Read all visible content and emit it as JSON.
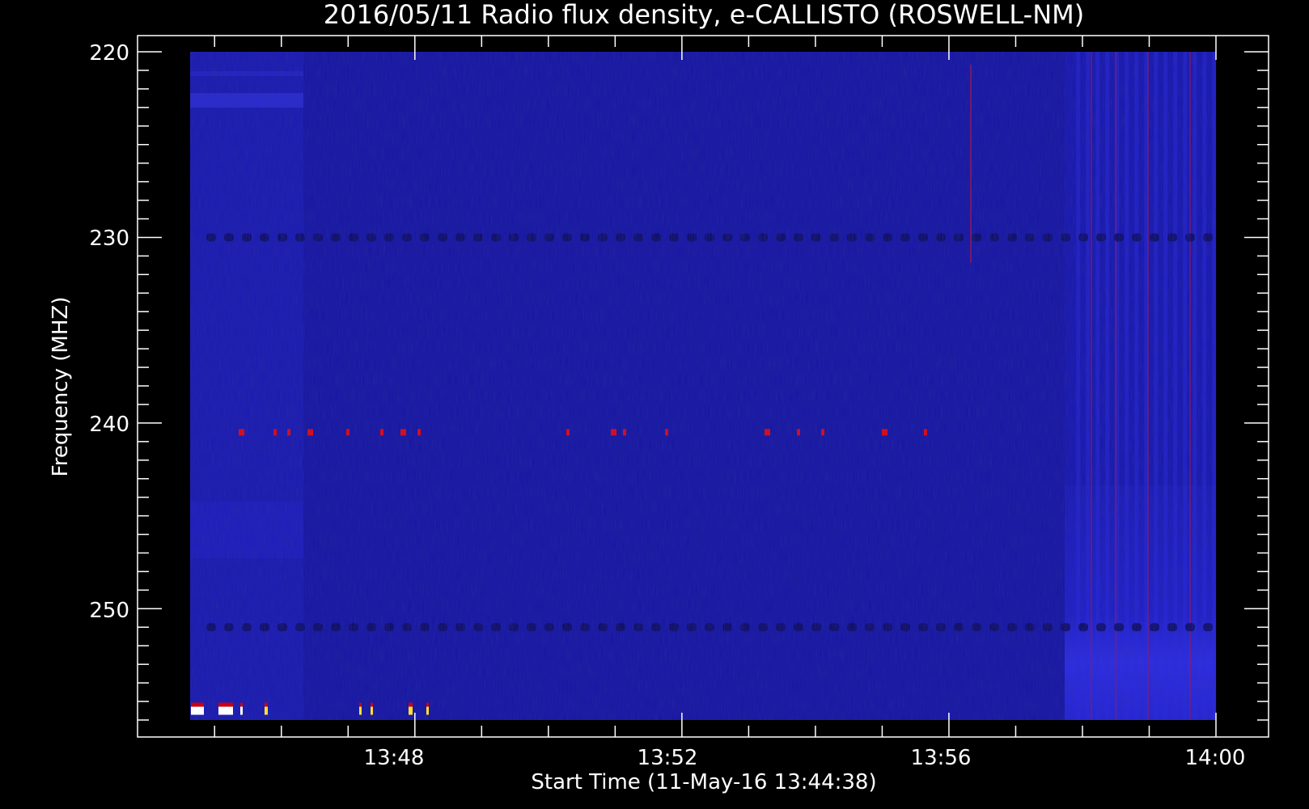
{
  "chart_data": {
    "type": "heatmap",
    "title": "2016/05/11  Radio flux density, e-CALLISTO (ROSWELL-NM)",
    "xlabel": "Start Time (11-May-16 13:44:38)",
    "ylabel": "Frequency (MHZ)",
    "x_ticks": [
      "13:48",
      "13:52",
      "13:56",
      "14:00"
    ],
    "y_ticks": [
      "220",
      "230",
      "240",
      "250"
    ],
    "y_range_mhz": [
      220,
      256
    ],
    "y_inverted": true,
    "x_range": [
      "13:44:38",
      "14:00:00"
    ],
    "colormap": [
      "#000014",
      "#1c1cd2",
      "#cc0010",
      "#ffe030",
      "#ffffff"
    ],
    "background_level": "medium-blue",
    "features": [
      {
        "label": "horizontal interference band",
        "freq_mhz": 230,
        "kind": "dark-dashed"
      },
      {
        "label": "horizontal interference band",
        "freq_mhz": 240.5,
        "kind": "red-blips"
      },
      {
        "label": "horizontal interference band",
        "freq_mhz": 251,
        "kind": "dark-dashed"
      },
      {
        "label": "bright interference",
        "freq_mhz": 255.5,
        "time_range": [
          "13:44:38",
          "13:48:30"
        ],
        "kind": "white-yellow"
      },
      {
        "label": "broadband noise region",
        "time_range": [
          "13:57:50",
          "14:00:00"
        ],
        "kind": "bright-blue-stripes"
      },
      {
        "label": "early brighter region",
        "time_range": [
          "13:44:38",
          "13:46:20"
        ],
        "kind": "brighter-blue"
      }
    ]
  }
}
